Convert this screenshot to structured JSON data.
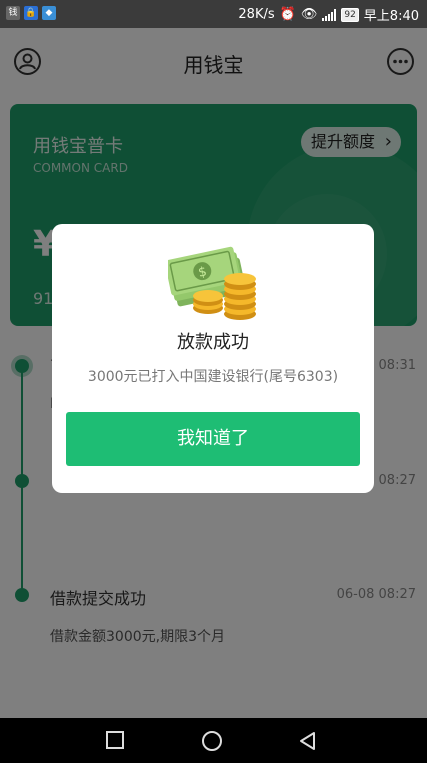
{
  "status_bar": {
    "net_speed": "28K/s",
    "battery": "92",
    "time": "早上8:40"
  },
  "header": {
    "title": "用钱宝",
    "user_icon": "user-circle-icon",
    "more_icon": "more-dots-icon"
  },
  "card": {
    "name": "用钱宝普卡",
    "sub": "COMMON CARD",
    "raise_label": "提升额度",
    "amount": "¥",
    "number": "91"
  },
  "timeline": {
    "items": [
      {
        "title": "7",
        "time": "08:31",
        "desc": "L"
      },
      {
        "title": "",
        "time": "08:27",
        "desc": ""
      },
      {
        "title": "借款提交成功",
        "time": "06-08 08:27",
        "desc": "借款金额3000元,期限3个月"
      }
    ]
  },
  "dialog": {
    "title": "放款成功",
    "message": "3000元已打入中国建设银行(尾号6303)",
    "button_label": "我知道了"
  },
  "colors": {
    "primary": "#1ebd74",
    "card": "#1f9f6a"
  }
}
